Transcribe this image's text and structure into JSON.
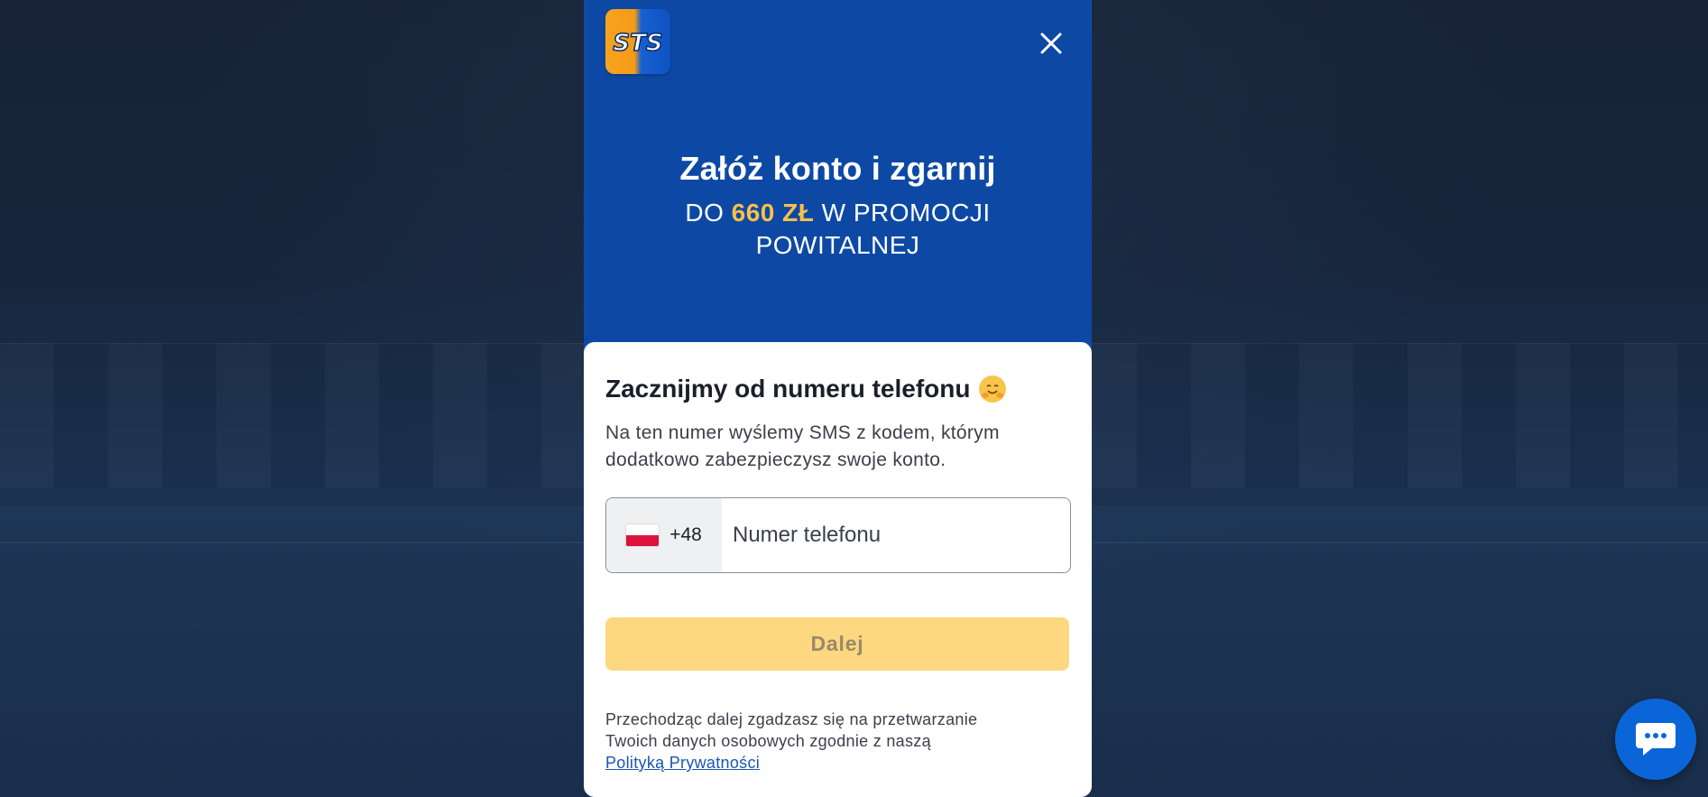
{
  "logo": {
    "text": "STS",
    "icon": "sts-logo-icon"
  },
  "modal": {
    "close_icon": "close-icon",
    "hero": {
      "title": "Załóż konto i zgarnij",
      "promo_prefix": "DO",
      "promo_amount": "660 ZŁ",
      "promo_suffix_line1": "W PROMOCJI",
      "promo_suffix_line2": "POWITALNEJ",
      "accent_color": "#f8c04a"
    }
  },
  "form": {
    "heading": "Zacznijmy od numeru telefonu",
    "heading_emoji": "hugging-face-emoji",
    "description": "Na ten numer wyślemy SMS z kodem, którym dodatkowo zabezpieczysz swoje konto.",
    "country": {
      "flag": "poland-flag-icon",
      "dial_code": "+48"
    },
    "phone_placeholder": "Numer telefonu",
    "phone_value": "",
    "next_button": "Dalej",
    "consent_text_line1": "Przechodząc dalej zgadzasz się na przetwarzanie",
    "consent_text_line2": "Twoich danych osobowych zgodnie z naszą",
    "privacy_link": "Polityką Prywatności"
  },
  "chat": {
    "icon": "chat-bubble-icon"
  },
  "colors": {
    "brand_blue": "#0d49a4",
    "button_yellow": "#fed781",
    "link_blue": "#1a55b5"
  }
}
